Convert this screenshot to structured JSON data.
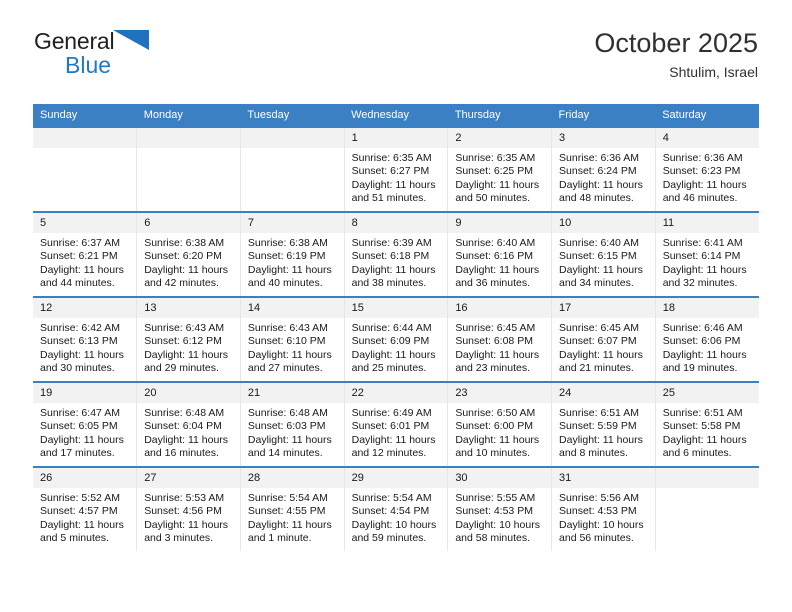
{
  "brand": {
    "name_top": "General",
    "name_bottom": "Blue",
    "triangle_color": "#1f72bd",
    "text_color": "#231f20",
    "blue_color": "#1f7ac4"
  },
  "header": {
    "title": "October 2025",
    "subtitle": "Shtulim, Israel"
  },
  "theme": {
    "header_row_bg": "#3b7fc4",
    "header_row_text": "#ffffff",
    "daynum_bg": "#f2f2f2",
    "cell_border": "#e6e6e6",
    "row_top_border": "#3b7fc4"
  },
  "weekdays": [
    "Sunday",
    "Monday",
    "Tuesday",
    "Wednesday",
    "Thursday",
    "Friday",
    "Saturday"
  ],
  "weeks": [
    [
      {
        "day": "",
        "sunrise": "",
        "sunset": "",
        "daylight_line1": "",
        "daylight_line2": ""
      },
      {
        "day": "",
        "sunrise": "",
        "sunset": "",
        "daylight_line1": "",
        "daylight_line2": ""
      },
      {
        "day": "",
        "sunrise": "",
        "sunset": "",
        "daylight_line1": "",
        "daylight_line2": ""
      },
      {
        "day": "1",
        "sunrise": "Sunrise: 6:35 AM",
        "sunset": "Sunset: 6:27 PM",
        "daylight_line1": "Daylight: 11 hours",
        "daylight_line2": "and 51 minutes."
      },
      {
        "day": "2",
        "sunrise": "Sunrise: 6:35 AM",
        "sunset": "Sunset: 6:25 PM",
        "daylight_line1": "Daylight: 11 hours",
        "daylight_line2": "and 50 minutes."
      },
      {
        "day": "3",
        "sunrise": "Sunrise: 6:36 AM",
        "sunset": "Sunset: 6:24 PM",
        "daylight_line1": "Daylight: 11 hours",
        "daylight_line2": "and 48 minutes."
      },
      {
        "day": "4",
        "sunrise": "Sunrise: 6:36 AM",
        "sunset": "Sunset: 6:23 PM",
        "daylight_line1": "Daylight: 11 hours",
        "daylight_line2": "and 46 minutes."
      }
    ],
    [
      {
        "day": "5",
        "sunrise": "Sunrise: 6:37 AM",
        "sunset": "Sunset: 6:21 PM",
        "daylight_line1": "Daylight: 11 hours",
        "daylight_line2": "and 44 minutes."
      },
      {
        "day": "6",
        "sunrise": "Sunrise: 6:38 AM",
        "sunset": "Sunset: 6:20 PM",
        "daylight_line1": "Daylight: 11 hours",
        "daylight_line2": "and 42 minutes."
      },
      {
        "day": "7",
        "sunrise": "Sunrise: 6:38 AM",
        "sunset": "Sunset: 6:19 PM",
        "daylight_line1": "Daylight: 11 hours",
        "daylight_line2": "and 40 minutes."
      },
      {
        "day": "8",
        "sunrise": "Sunrise: 6:39 AM",
        "sunset": "Sunset: 6:18 PM",
        "daylight_line1": "Daylight: 11 hours",
        "daylight_line2": "and 38 minutes."
      },
      {
        "day": "9",
        "sunrise": "Sunrise: 6:40 AM",
        "sunset": "Sunset: 6:16 PM",
        "daylight_line1": "Daylight: 11 hours",
        "daylight_line2": "and 36 minutes."
      },
      {
        "day": "10",
        "sunrise": "Sunrise: 6:40 AM",
        "sunset": "Sunset: 6:15 PM",
        "daylight_line1": "Daylight: 11 hours",
        "daylight_line2": "and 34 minutes."
      },
      {
        "day": "11",
        "sunrise": "Sunrise: 6:41 AM",
        "sunset": "Sunset: 6:14 PM",
        "daylight_line1": "Daylight: 11 hours",
        "daylight_line2": "and 32 minutes."
      }
    ],
    [
      {
        "day": "12",
        "sunrise": "Sunrise: 6:42 AM",
        "sunset": "Sunset: 6:13 PM",
        "daylight_line1": "Daylight: 11 hours",
        "daylight_line2": "and 30 minutes."
      },
      {
        "day": "13",
        "sunrise": "Sunrise: 6:43 AM",
        "sunset": "Sunset: 6:12 PM",
        "daylight_line1": "Daylight: 11 hours",
        "daylight_line2": "and 29 minutes."
      },
      {
        "day": "14",
        "sunrise": "Sunrise: 6:43 AM",
        "sunset": "Sunset: 6:10 PM",
        "daylight_line1": "Daylight: 11 hours",
        "daylight_line2": "and 27 minutes."
      },
      {
        "day": "15",
        "sunrise": "Sunrise: 6:44 AM",
        "sunset": "Sunset: 6:09 PM",
        "daylight_line1": "Daylight: 11 hours",
        "daylight_line2": "and 25 minutes."
      },
      {
        "day": "16",
        "sunrise": "Sunrise: 6:45 AM",
        "sunset": "Sunset: 6:08 PM",
        "daylight_line1": "Daylight: 11 hours",
        "daylight_line2": "and 23 minutes."
      },
      {
        "day": "17",
        "sunrise": "Sunrise: 6:45 AM",
        "sunset": "Sunset: 6:07 PM",
        "daylight_line1": "Daylight: 11 hours",
        "daylight_line2": "and 21 minutes."
      },
      {
        "day": "18",
        "sunrise": "Sunrise: 6:46 AM",
        "sunset": "Sunset: 6:06 PM",
        "daylight_line1": "Daylight: 11 hours",
        "daylight_line2": "and 19 minutes."
      }
    ],
    [
      {
        "day": "19",
        "sunrise": "Sunrise: 6:47 AM",
        "sunset": "Sunset: 6:05 PM",
        "daylight_line1": "Daylight: 11 hours",
        "daylight_line2": "and 17 minutes."
      },
      {
        "day": "20",
        "sunrise": "Sunrise: 6:48 AM",
        "sunset": "Sunset: 6:04 PM",
        "daylight_line1": "Daylight: 11 hours",
        "daylight_line2": "and 16 minutes."
      },
      {
        "day": "21",
        "sunrise": "Sunrise: 6:48 AM",
        "sunset": "Sunset: 6:03 PM",
        "daylight_line1": "Daylight: 11 hours",
        "daylight_line2": "and 14 minutes."
      },
      {
        "day": "22",
        "sunrise": "Sunrise: 6:49 AM",
        "sunset": "Sunset: 6:01 PM",
        "daylight_line1": "Daylight: 11 hours",
        "daylight_line2": "and 12 minutes."
      },
      {
        "day": "23",
        "sunrise": "Sunrise: 6:50 AM",
        "sunset": "Sunset: 6:00 PM",
        "daylight_line1": "Daylight: 11 hours",
        "daylight_line2": "and 10 minutes."
      },
      {
        "day": "24",
        "sunrise": "Sunrise: 6:51 AM",
        "sunset": "Sunset: 5:59 PM",
        "daylight_line1": "Daylight: 11 hours",
        "daylight_line2": "and 8 minutes."
      },
      {
        "day": "25",
        "sunrise": "Sunrise: 6:51 AM",
        "sunset": "Sunset: 5:58 PM",
        "daylight_line1": "Daylight: 11 hours",
        "daylight_line2": "and 6 minutes."
      }
    ],
    [
      {
        "day": "26",
        "sunrise": "Sunrise: 5:52 AM",
        "sunset": "Sunset: 4:57 PM",
        "daylight_line1": "Daylight: 11 hours",
        "daylight_line2": "and 5 minutes."
      },
      {
        "day": "27",
        "sunrise": "Sunrise: 5:53 AM",
        "sunset": "Sunset: 4:56 PM",
        "daylight_line1": "Daylight: 11 hours",
        "daylight_line2": "and 3 minutes."
      },
      {
        "day": "28",
        "sunrise": "Sunrise: 5:54 AM",
        "sunset": "Sunset: 4:55 PM",
        "daylight_line1": "Daylight: 11 hours",
        "daylight_line2": "and 1 minute."
      },
      {
        "day": "29",
        "sunrise": "Sunrise: 5:54 AM",
        "sunset": "Sunset: 4:54 PM",
        "daylight_line1": "Daylight: 10 hours",
        "daylight_line2": "and 59 minutes."
      },
      {
        "day": "30",
        "sunrise": "Sunrise: 5:55 AM",
        "sunset": "Sunset: 4:53 PM",
        "daylight_line1": "Daylight: 10 hours",
        "daylight_line2": "and 58 minutes."
      },
      {
        "day": "31",
        "sunrise": "Sunrise: 5:56 AM",
        "sunset": "Sunset: 4:53 PM",
        "daylight_line1": "Daylight: 10 hours",
        "daylight_line2": "and 56 minutes."
      },
      {
        "day": "",
        "sunrise": "",
        "sunset": "",
        "daylight_line1": "",
        "daylight_line2": ""
      }
    ]
  ]
}
